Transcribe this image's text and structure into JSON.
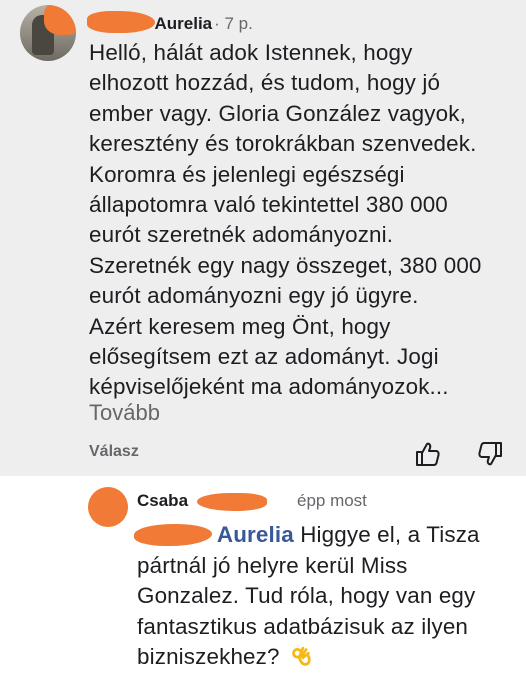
{
  "comment": {
    "author_visible": "Aurelia",
    "time": "· 7 p.",
    "body_lines": [
      "Helló, hálát adok Istennek, hogy",
      "elhozott hozzád, és tudom, hogy jó",
      "ember vagy. Gloria González vagyok,",
      "keresztény és torokrákban szenvedek.",
      "Koromra és jelenlegi egészségi",
      "állapotomra való tekintettel 380 000",
      "eurót szeretnék adományozni.",
      "Szeretnék egy nagy összeget, 380 000",
      "eurót adományozni egy jó ügyre.",
      "Azért keresem meg Önt, hogy",
      "elősegítsem ezt az adományt. Jogi",
      "képviselőjeként ma adományozok..."
    ],
    "more_label": "Tovább",
    "reply_label": "Válasz",
    "like_icon": "thumbs-up-icon",
    "dislike_icon": "thumbs-down-icon"
  },
  "reply": {
    "author_visible": "Csaba",
    "time": "épp most",
    "mention_visible": "Aurelia",
    "line1_rest": " Higgye el, a Tisza",
    "lines": [
      "pártnál jó helyre kerül Miss",
      "Gonzalez. Tud róla, hogy van egy",
      "fantasztikus adatbázisuk az ilyen"
    ],
    "last_line": "bizniszekhez?",
    "emoji": "ok-hand-emoji"
  },
  "colors": {
    "redaction": "#f07a36",
    "mention": "#385898",
    "muted": "#65676b",
    "comment_bg": "#eeeeee"
  }
}
